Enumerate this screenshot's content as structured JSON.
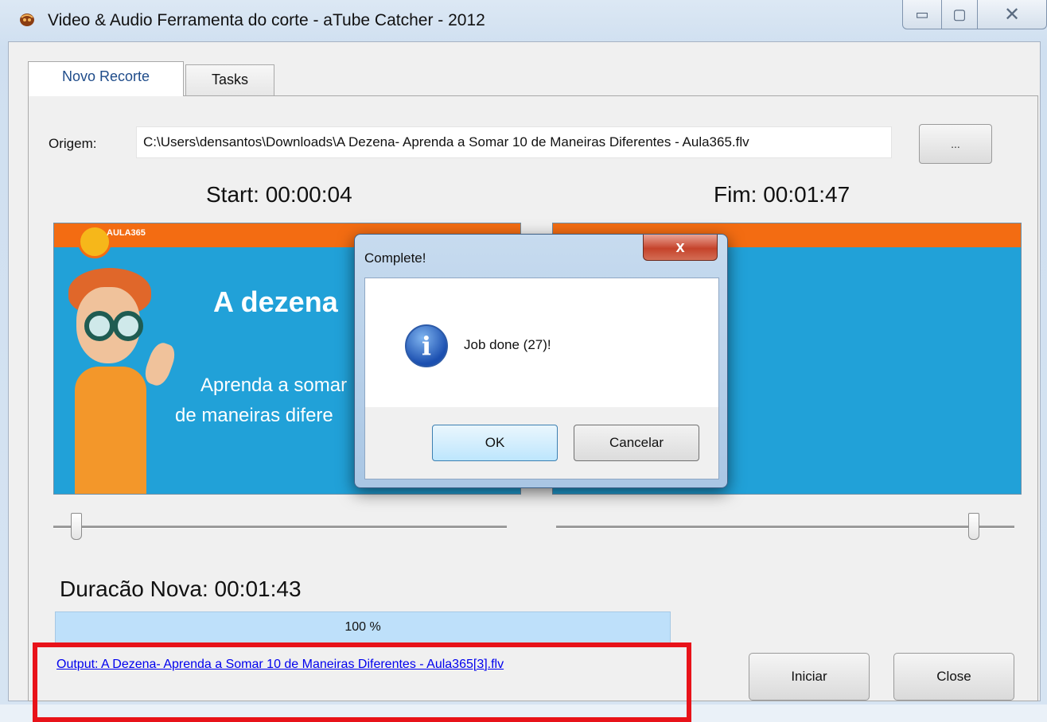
{
  "window": {
    "title": "Video & Audio Ferramenta do corte - aTube Catcher - 2012",
    "controls": {
      "minimize": "▭",
      "maximize": "▢",
      "close": "✕"
    }
  },
  "tabs": [
    {
      "label": "Novo Recorte",
      "active": true
    },
    {
      "label": "Tasks",
      "active": false
    }
  ],
  "origin": {
    "label": "Origem:",
    "value": "C:\\Users\\densantos\\Downloads\\A Dezena- Aprenda a Somar 10 de Maneiras Diferentes - Aula365.flv",
    "browse_label": "..."
  },
  "start": {
    "text": "Start: 00:00:04"
  },
  "end": {
    "text": "Fim: 00:01:47"
  },
  "preview": {
    "brand": "AULA365",
    "title": "A dezena",
    "subtitle_line1": "Aprenda a somar",
    "subtitle_line2": "de maneiras difere"
  },
  "duration": {
    "text": "Duracão Nova: 00:01:43"
  },
  "progress": {
    "percent": 100,
    "text": "100 %"
  },
  "output": {
    "text": "Output: A Dezena- Aprenda a Somar 10 de Maneiras Diferentes - Aula365[3].flv"
  },
  "buttons": {
    "start": "Iniciar",
    "close": "Close"
  },
  "dialog": {
    "title": "Complete!",
    "message": "Job done (27)!",
    "ok": "OK",
    "cancel": "Cancelar",
    "close_glyph": "x"
  },
  "colors": {
    "highlight": "#e8131a",
    "progress": "#bee0fa",
    "video_bg": "#21a1d8",
    "video_bar": "#f36c12"
  }
}
